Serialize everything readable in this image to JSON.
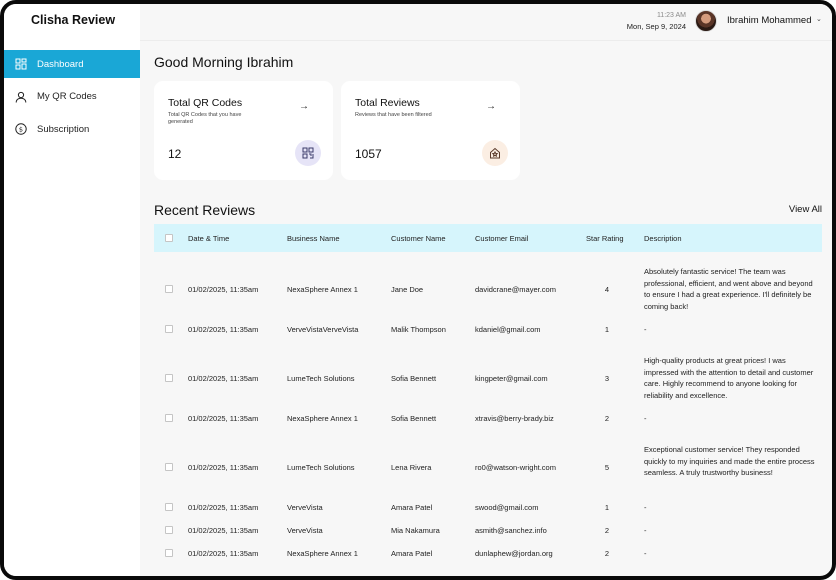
{
  "sidebar": {
    "brand": "Clisha Review",
    "items": [
      {
        "label": "Dashboard",
        "icon": "dashboard-icon"
      },
      {
        "label": "My QR Codes",
        "icon": "user-icon"
      },
      {
        "label": "Subscription",
        "icon": "dollar-icon"
      }
    ]
  },
  "header": {
    "time": "11:23 AM",
    "date": "Mon, Sep 9, 2024",
    "user_name": "Ibrahim Mohammed"
  },
  "greeting": "Good Morning Ibrahim",
  "cards": [
    {
      "title": "Total QR Codes",
      "subtitle": "Total QR Codes that you have generated",
      "value": "12"
    },
    {
      "title": "Total Reviews",
      "subtitle": "Reviews that have been filtered",
      "value": "1057"
    }
  ],
  "reviews": {
    "title": "Recent Reviews",
    "view_all": "View All",
    "columns": [
      "Date & Time",
      "Business Name",
      "Customer Name",
      "Customer Email",
      "Star Rating",
      "Description"
    ],
    "rows": [
      {
        "datetime": "01/02/2025, 11:35am",
        "business": "NexaSphere Annex 1",
        "customer": "Jane Doe",
        "email": "davidcrane@mayer.com",
        "rating": "4",
        "description": "Absolutely fantastic service! The team was professional, efficient, and went above and beyond to ensure I had a great experience. I'll definitely be coming back!"
      },
      {
        "datetime": "01/02/2025, 11:35am",
        "business": "VerveVistaVerveVista",
        "customer": "Malik Thompson",
        "email": "kdaniel@gmail.com",
        "rating": "1",
        "description": "-"
      },
      {
        "datetime": "01/02/2025, 11:35am",
        "business": "LumeTech Solutions",
        "customer": "Sofia Bennett",
        "email": "kingpeter@gmail.com",
        "rating": "3",
        "description": "High-quality products at great prices! I was impressed with the attention to detail and customer care. Highly recommend to anyone looking for reliability and excellence."
      },
      {
        "datetime": "01/02/2025, 11:35am",
        "business": "NexaSphere Annex 1",
        "customer": "Sofia Bennett",
        "email": "xtravis@berry-brady.biz",
        "rating": "2",
        "description": "-"
      },
      {
        "datetime": "01/02/2025, 11:35am",
        "business": "LumeTech Solutions",
        "customer": "Lena Rivera",
        "email": "ro0@watson-wright.com",
        "rating": "5",
        "description": "Exceptional customer service! They responded quickly to my inquiries and made the entire process seamless. A truly trustworthy business!"
      },
      {
        "datetime": "01/02/2025, 11:35am",
        "business": "VerveVista",
        "customer": "Amara Patel",
        "email": "swood@gmail.com",
        "rating": "1",
        "description": "-"
      },
      {
        "datetime": "01/02/2025, 11:35am",
        "business": "VerveVista",
        "customer": "Mia Nakamura",
        "email": "asmith@sanchez.info",
        "rating": "2",
        "description": "-"
      },
      {
        "datetime": "01/02/2025, 11:35am",
        "business": "NexaSphere Annex 1",
        "customer": "Amara Patel",
        "email": "dunlaphew@jordan.org",
        "rating": "2",
        "description": "-"
      }
    ]
  },
  "colors": {
    "accent": "#1aa7d6",
    "table_header": "#d6f5fc",
    "qr_icon_bg": "#e6e4f7",
    "review_icon_bg": "#fbeee3"
  }
}
